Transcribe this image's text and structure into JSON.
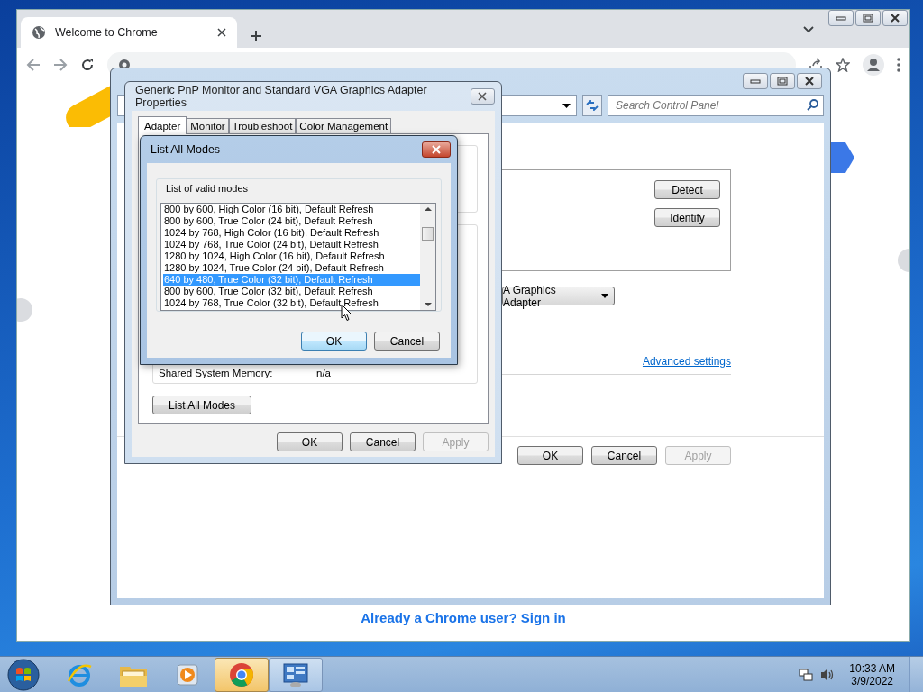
{
  "chrome": {
    "tab": {
      "title": "Welcome to Chrome"
    },
    "sign_in": "Already a Chrome user? Sign in"
  },
  "control_panel": {
    "search": {
      "placeholder": "Search Control Panel"
    },
    "monitor_buttons": [
      "Detect",
      "Identify"
    ],
    "display_dropdown": {
      "value": "A Graphics Adapter"
    },
    "advanced_link": "Advanced settings",
    "buttons": [
      {
        "label": "OK",
        "disabled": false
      },
      {
        "label": "Cancel",
        "disabled": false
      },
      {
        "label": "Apply",
        "disabled": true
      }
    ]
  },
  "properties": {
    "title": "Generic PnP Monitor and Standard VGA Graphics Adapter Properties",
    "tabs": [
      {
        "label": "Adapter",
        "selected": true
      },
      {
        "label": "Monitor",
        "selected": false
      },
      {
        "label": "Troubleshoot",
        "selected": false
      },
      {
        "label": "Color Management",
        "selected": false
      }
    ],
    "shared_memory": {
      "label": "Shared System Memory:",
      "value": "n/a"
    },
    "list_all_modes_button": "List All Modes",
    "buttons": [
      {
        "label": "OK",
        "disabled": false
      },
      {
        "label": "Cancel",
        "disabled": false
      },
      {
        "label": "Apply",
        "disabled": true
      }
    ]
  },
  "list_modes": {
    "title": "List All Modes",
    "group": "List of valid modes",
    "modes": [
      {
        "label": "800 by 600, High Color (16 bit), Default Refresh",
        "selected": false
      },
      {
        "label": "800 by 600, True Color (24 bit), Default Refresh",
        "selected": false
      },
      {
        "label": "1024 by 768, High Color (16 bit), Default Refresh",
        "selected": false
      },
      {
        "label": "1024 by 768, True Color (24 bit), Default Refresh",
        "selected": false
      },
      {
        "label": "1280 by 1024, High Color (16 bit), Default Refresh",
        "selected": false
      },
      {
        "label": "1280 by 1024, True Color (24 bit), Default Refresh",
        "selected": false
      },
      {
        "label": "640 by 480, True Color (32 bit), Default Refresh",
        "selected": true
      },
      {
        "label": "800 by 600, True Color (32 bit), Default Refresh",
        "selected": false
      },
      {
        "label": "1024 by 768, True Color (32 bit), Default Refresh",
        "selected": false
      }
    ],
    "buttons": [
      {
        "label": "OK",
        "default": true
      },
      {
        "label": "Cancel",
        "default": false
      }
    ]
  },
  "taskbar": {
    "apps": [
      {
        "kind": "browser-e",
        "active": false,
        "open": false
      },
      {
        "kind": "folder",
        "active": false,
        "open": false
      },
      {
        "kind": "media",
        "active": false,
        "open": false
      },
      {
        "kind": "chrome",
        "active": true,
        "open": true
      },
      {
        "kind": "control-panel",
        "active": false,
        "open": true
      }
    ],
    "clock": {
      "time": "10:33 AM",
      "date": "3/9/2022"
    }
  }
}
